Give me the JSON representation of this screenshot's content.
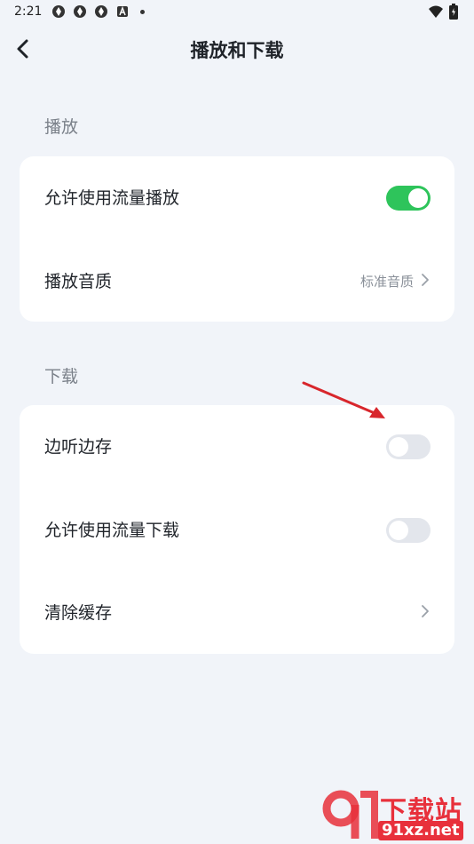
{
  "status_bar": {
    "time": "2:21",
    "left_icons": [
      "app-icon",
      "app-icon",
      "app-icon",
      "a-icon",
      "dot"
    ],
    "right_icons": [
      "wifi-icon",
      "battery-icon"
    ]
  },
  "header": {
    "title": "播放和下载",
    "back_icon": "chevron-left-icon"
  },
  "sections": [
    {
      "header": "播放",
      "rows": [
        {
          "label": "允许使用流量播放",
          "control": "toggle",
          "on": true
        },
        {
          "label": "播放音质",
          "value": "标准音质",
          "control": "chevron"
        }
      ]
    },
    {
      "header": "下载",
      "rows": [
        {
          "label": "边听边存",
          "control": "toggle",
          "on": false
        },
        {
          "label": "允许使用流量下载",
          "control": "toggle",
          "on": false
        },
        {
          "label": "清除缓存",
          "control": "chevron"
        }
      ]
    }
  ],
  "colors": {
    "background": "#f1f4f9",
    "toggle_on": "#2ec45b",
    "toggle_off": "#e3e6ec",
    "annotation_arrow": "#d8262c",
    "watermark": "#e8303b"
  },
  "watermark": {
    "name": "下载站",
    "url": "91xz.net"
  }
}
